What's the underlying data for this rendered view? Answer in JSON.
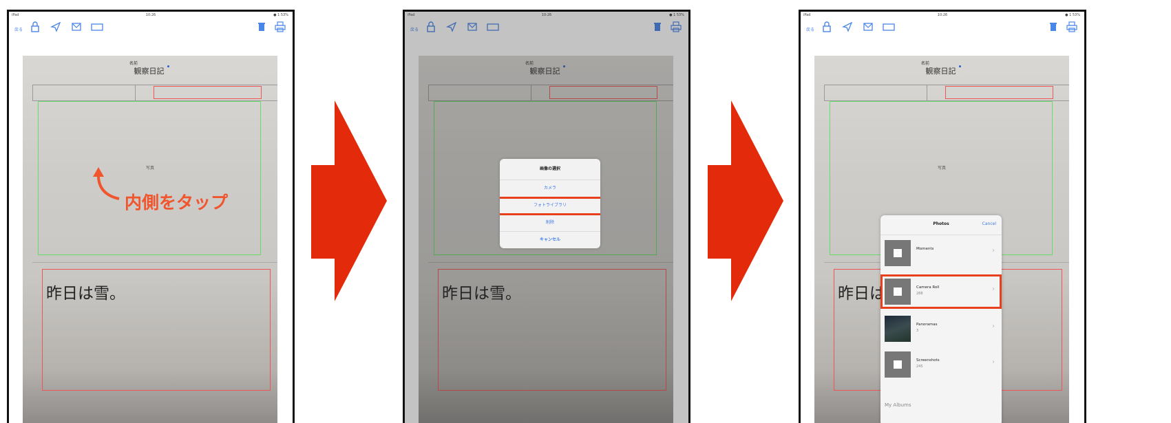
{
  "status": {
    "carrier": "iPad",
    "time": "10:26",
    "battery": "● 1 53%"
  },
  "toolbar": {
    "back_label": "戻る"
  },
  "document": {
    "title": "観察日記",
    "name_label": "名前",
    "photo_label": "写真",
    "text": "昨日は雪。"
  },
  "hint": {
    "text": "内側をタップ"
  },
  "action_sheet": {
    "title": "画像の選択",
    "options": [
      "カメラ",
      "フォトライブラリ",
      "削除",
      "キャンセル"
    ]
  },
  "photos_popover": {
    "title": "Photos",
    "cancel": "Cancel",
    "albums": [
      {
        "name": "Moments",
        "count": ""
      },
      {
        "name": "Camera Roll",
        "count": "288"
      },
      {
        "name": "Panoramas",
        "count": "3"
      },
      {
        "name": "Screenshots",
        "count": "245"
      }
    ],
    "my_albums_label": "My Albums"
  },
  "colors": {
    "arrow": "#e32a0a",
    "highlight": "#e8401c",
    "ios_blue": "#3b78e7"
  }
}
